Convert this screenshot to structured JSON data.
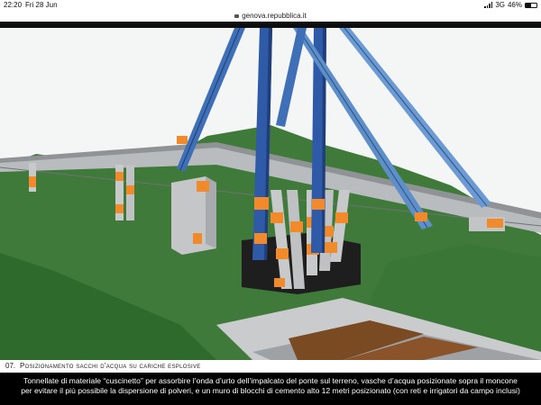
{
  "status": {
    "time": "22:20",
    "date": "Fri 28 Jun",
    "network": "3G",
    "battery": "46%"
  },
  "browser": {
    "url": "genova.repubblica.it"
  },
  "figure": {
    "number": "07.",
    "caption": "Posizionamento sacchi d'acqua su cariche esplosive"
  },
  "article": {
    "subtitle_line1": "Tonnellate di materiale “cuscinetto” per assorbire l’onda d’urto dell’impalcato del ponte sul terreno, vasche d’acqua posizionate sopra il moncone",
    "subtitle_line2": "per evitare il più possibile la dispersione di polveri, e un muro di blocchi di cemento alto 12 metri posizionato (con reti e irrigatori da campo inclusi)"
  },
  "colors": {
    "terrain": "#3f7a3b",
    "pylon": "#2f5aa8",
    "deck": "#b9bcbf",
    "water_bags": "#f08a2a",
    "black_block": "#1e1e1e"
  }
}
